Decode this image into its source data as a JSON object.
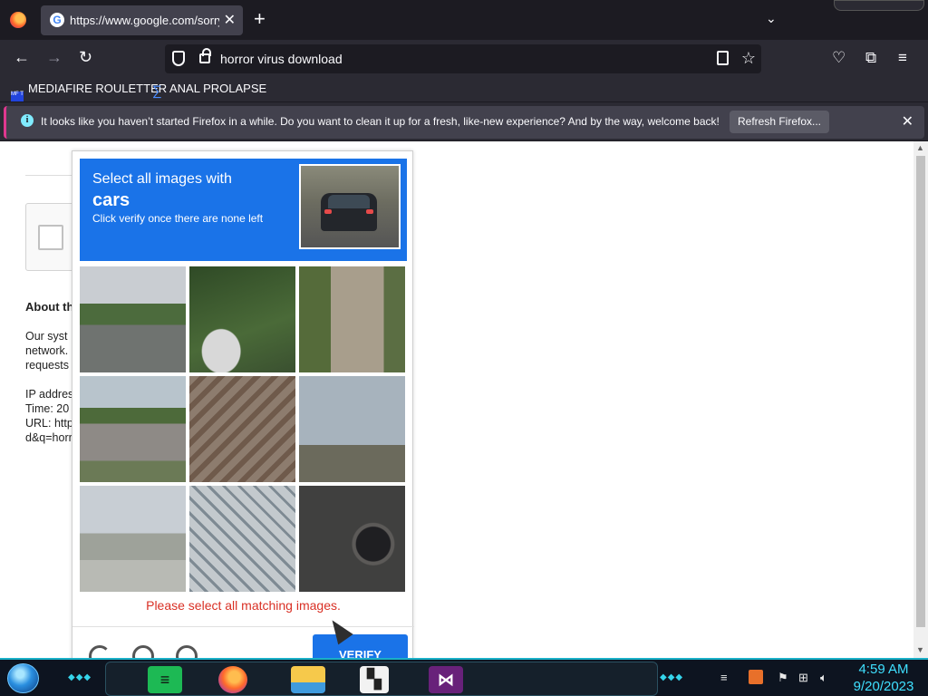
{
  "browser": {
    "tab": {
      "title": "https://www.google.com/sorry/index",
      "favicon": "google-icon"
    },
    "address_bar": {
      "value": "horror virus download"
    },
    "bookmarks": [
      {
        "label": "MEDIAFIRE ROULETTER",
        "icon": "mediafire-icon",
        "icon_text": "MF T"
      },
      {
        "label": "ANAL PROLAPSE",
        "icon": "sigma-icon"
      }
    ],
    "notification": {
      "text": "It looks like you haven’t started Firefox in a while. Do you want to clean it up for a fresh, like-new experience? And by the way, welcome back!",
      "button": "Refresh Firefox..."
    }
  },
  "background_page": {
    "about_title": "About th",
    "lines": [
      "Our syst",
      "network.",
      "requests",
      "",
      "IP addres",
      "Time: 20",
      "URL: http",
      "d&q=horr"
    ]
  },
  "captcha": {
    "instruction": "Select all images with",
    "target": "cars",
    "hint": "Click verify once there are none left",
    "error": "Please select all matching images.",
    "verify_label": "VERIFY",
    "tiles": [
      {
        "name": "road-trees"
      },
      {
        "name": "guardrail"
      },
      {
        "name": "chimney"
      },
      {
        "name": "house"
      },
      {
        "name": "stairs"
      },
      {
        "name": "sky-buildings"
      },
      {
        "name": "highway-fence"
      },
      {
        "name": "bridge"
      },
      {
        "name": "motorcycle"
      }
    ]
  },
  "taskbar": {
    "apps": [
      "spotify-icon",
      "firefox-icon",
      "file-explorer-icon",
      "app-icon",
      "visual-studio-icon"
    ],
    "clock": {
      "time": "4:59 AM",
      "date": "9/20/2023"
    }
  },
  "colors": {
    "captcha_blue": "#1a73e8",
    "error_red": "#d93025",
    "firefox_dark": "#1c1b22",
    "taskbar_accent": "#35d4ea"
  }
}
